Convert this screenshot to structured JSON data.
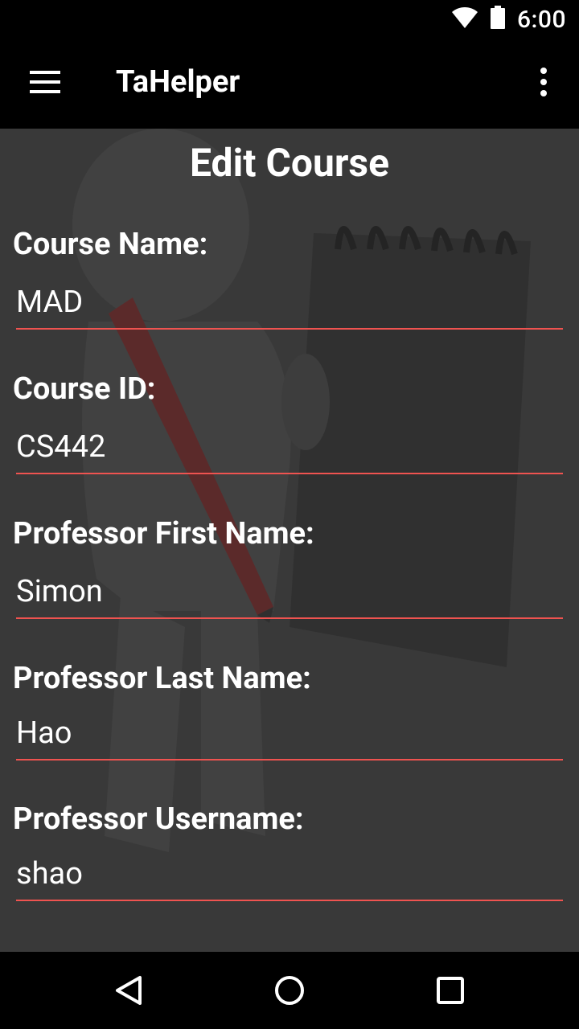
{
  "status_bar": {
    "time": "6:00"
  },
  "app_bar": {
    "title": "TaHelper"
  },
  "page": {
    "title": "Edit Course"
  },
  "fields": [
    {
      "label": "Course Name:",
      "value": "MAD"
    },
    {
      "label": "Course ID:",
      "value": "CS442"
    },
    {
      "label": "Professor First Name:",
      "value": "Simon"
    },
    {
      "label": "Professor Last Name:",
      "value": "Hao"
    },
    {
      "label": "Professor Username:",
      "value": "shao"
    }
  ],
  "colors": {
    "accent_underline": "#ef5350",
    "background": "#3a3a3a",
    "bars": "#000000"
  },
  "icons": [
    "wifi-icon",
    "battery-icon",
    "menu-icon",
    "overflow-menu-icon",
    "back-icon",
    "home-icon",
    "recents-icon"
  ]
}
